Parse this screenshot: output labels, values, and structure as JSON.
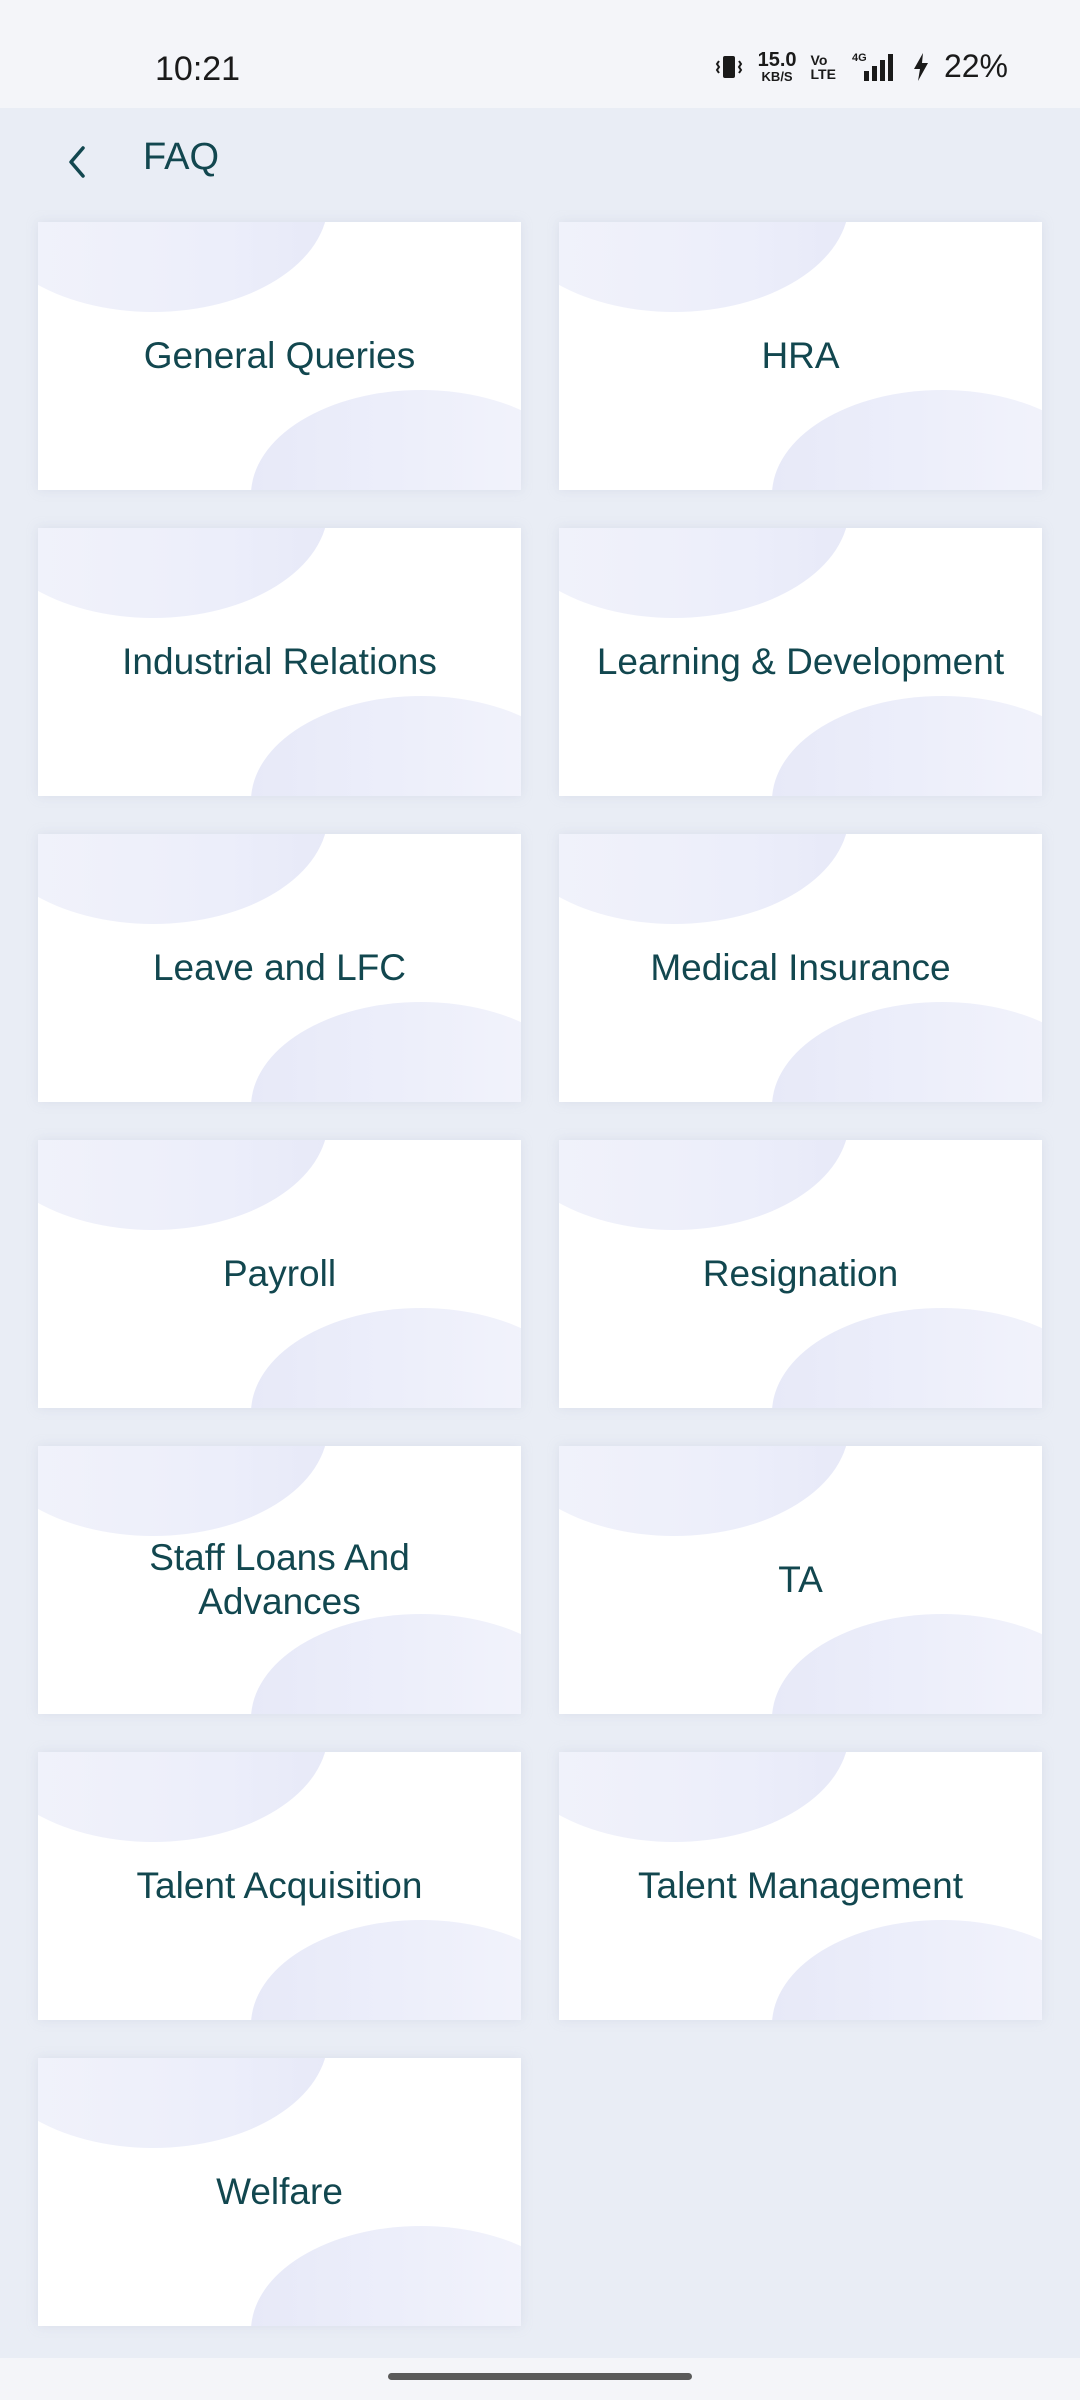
{
  "status_bar": {
    "time": "10:21",
    "net_speed_value": "15.0",
    "net_speed_unit": "KB/S",
    "volte_top": "Vo",
    "volte_bottom": "LTE",
    "network_label": "4G",
    "battery_percent": "22%"
  },
  "header": {
    "title": "FAQ",
    "back_icon": "chevron-left-icon"
  },
  "categories": [
    {
      "label": "General Queries"
    },
    {
      "label": "HRA"
    },
    {
      "label": "Industrial Relations"
    },
    {
      "label": "Learning & Development"
    },
    {
      "label": "Leave and LFC"
    },
    {
      "label": "Medical Insurance"
    },
    {
      "label": "Payroll"
    },
    {
      "label": "Resignation"
    },
    {
      "label": "Staff Loans And Advances"
    },
    {
      "label": "TA"
    },
    {
      "label": "Talent Acquisition"
    },
    {
      "label": "Talent Management"
    },
    {
      "label": "Welfare"
    }
  ],
  "colors": {
    "text_primary": "#12474f",
    "page_background": "#e9edf5",
    "card_background": "#ffffff",
    "blob_tint": "#eceefa"
  }
}
